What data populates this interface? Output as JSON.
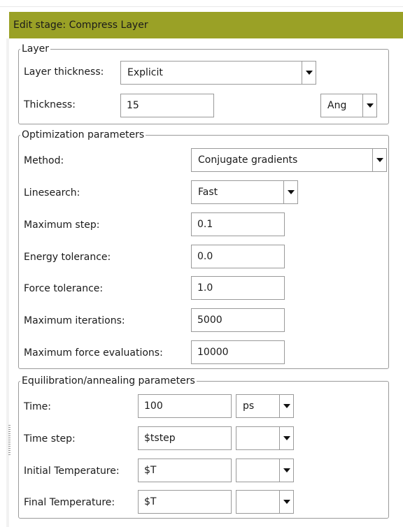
{
  "header": {
    "title": "Edit stage: Compress Layer"
  },
  "layer": {
    "legend": "Layer",
    "thickness_mode_label": "Layer thickness:",
    "thickness_mode_value": "Explicit",
    "thickness_label": "Thickness:",
    "thickness_value": "15",
    "thickness_unit": "Ang"
  },
  "optimization": {
    "legend": "Optimization parameters",
    "method_label": "Method:",
    "method_value": "Conjugate gradients",
    "linesearch_label": "Linesearch:",
    "linesearch_value": "Fast",
    "max_step_label": "Maximum step:",
    "max_step_value": "0.1",
    "energy_tol_label": "Energy tolerance:",
    "energy_tol_value": "0.0",
    "force_tol_label": "Force tolerance:",
    "force_tol_value": "1.0",
    "max_iter_label": "Maximum iterations:",
    "max_iter_value": "5000",
    "max_force_eval_label": "Maximum force evaluations:",
    "max_force_eval_value": "10000"
  },
  "equilibration": {
    "legend": "Equilibration/annealing parameters",
    "time_label": "Time:",
    "time_value": "100",
    "time_unit": "ps",
    "timestep_label": "Time step:",
    "timestep_value": "$tstep",
    "timestep_unit": "",
    "init_temp_label": "Initial Temperature:",
    "init_temp_value": "$T",
    "init_temp_unit": "",
    "final_temp_label": "Final Temperature:",
    "final_temp_value": "$T",
    "final_temp_unit": ""
  },
  "colors": {
    "header_bg": "#9aa126",
    "border": "#9a9a9a"
  },
  "icons": {
    "dropdown": "chevron-down-icon",
    "splitter": "splitter-grip-icon"
  }
}
